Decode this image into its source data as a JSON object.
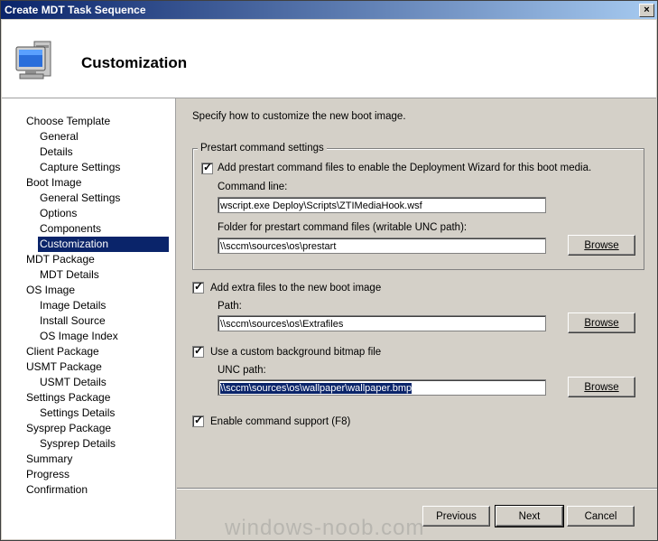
{
  "window": {
    "title": "Create MDT Task Sequence",
    "close_glyph": "×"
  },
  "header": {
    "title": "Customization",
    "icon": "computer-monitor-icon"
  },
  "nav": {
    "items": [
      {
        "label": "Choose Template",
        "indent": 0
      },
      {
        "label": "General",
        "indent": 1
      },
      {
        "label": "Details",
        "indent": 1
      },
      {
        "label": "Capture Settings",
        "indent": 1
      },
      {
        "label": "Boot Image",
        "indent": 0
      },
      {
        "label": "General Settings",
        "indent": 1
      },
      {
        "label": "Options",
        "indent": 1
      },
      {
        "label": "Components",
        "indent": 1
      },
      {
        "label": "Customization",
        "indent": 1,
        "selected": true
      },
      {
        "label": "MDT Package",
        "indent": 0
      },
      {
        "label": "MDT Details",
        "indent": 1
      },
      {
        "label": "OS Image",
        "indent": 0
      },
      {
        "label": "Image Details",
        "indent": 1
      },
      {
        "label": "Install Source",
        "indent": 1
      },
      {
        "label": "OS Image Index",
        "indent": 1
      },
      {
        "label": "Client Package",
        "indent": 0
      },
      {
        "label": "USMT Package",
        "indent": 0
      },
      {
        "label": "USMT Details",
        "indent": 1
      },
      {
        "label": "Settings Package",
        "indent": 0
      },
      {
        "label": "Settings Details",
        "indent": 1
      },
      {
        "label": "Sysprep Package",
        "indent": 0
      },
      {
        "label": "Sysprep Details",
        "indent": 1
      },
      {
        "label": "Summary",
        "indent": 0
      },
      {
        "label": "Progress",
        "indent": 0
      },
      {
        "label": "Confirmation",
        "indent": 0
      }
    ]
  },
  "main": {
    "intro": "Specify how to customize the new boot image.",
    "prestart": {
      "group_title": "Prestart command settings",
      "checkbox_label": "Add prestart command files to enable the Deployment Wizard for this boot media.",
      "checked": true,
      "command_line_label": "Command line:",
      "command_line_value": "wscript.exe Deploy\\Scripts\\ZTIMediaHook.wsf",
      "folder_label": "Folder for prestart command files (writable UNC path):",
      "folder_value": "\\\\sccm\\sources\\os\\prestart",
      "browse_label": "Browse"
    },
    "extra_files": {
      "checkbox_label": "Add extra files to the new boot image",
      "checked": true,
      "path_label": "Path:",
      "path_value": "\\\\sccm\\sources\\os\\Extrafiles",
      "browse_label": "Browse"
    },
    "background": {
      "checkbox_label": "Use a custom background bitmap file",
      "checked": true,
      "unc_label": "UNC path:",
      "unc_value": "\\\\sccm\\sources\\os\\wallpaper\\wallpaper.bmp",
      "browse_label": "Browse"
    },
    "command_support": {
      "checkbox_label": "Enable command support (F8)",
      "checked": true
    }
  },
  "footer": {
    "previous_label": "Previous",
    "next_label": "Next",
    "cancel_label": "Cancel"
  },
  "watermark": "windows-noob.com"
}
